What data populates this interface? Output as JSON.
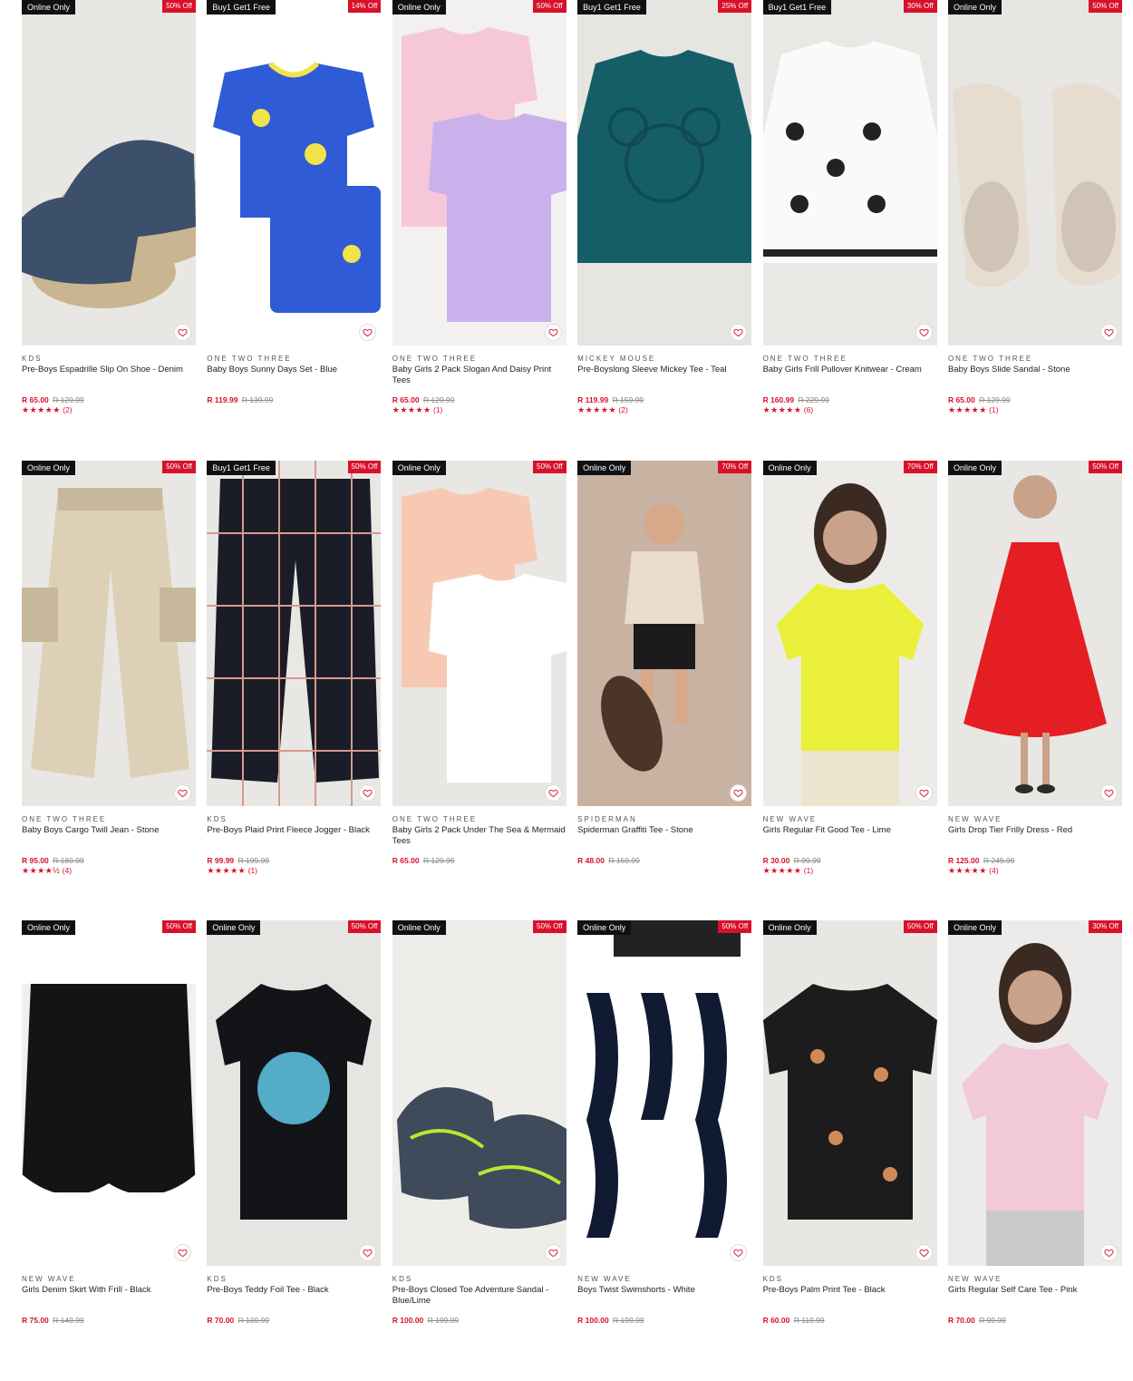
{
  "colors": {
    "accent": "#d8112b",
    "tag_bg": "#111111",
    "image_bg": "#e7e6e3"
  },
  "products": [
    {
      "tag": "Online Only",
      "discount": "50% Off",
      "brand": "KDS",
      "name": "Pre-Boys Espadrille Slip On Shoe - Denim",
      "price": "R 65.00",
      "was": "R 129.99",
      "stars": "★★★★★",
      "reviews": "(2)",
      "art": "shoe",
      "bg": "#e8e7e4",
      "c1": "#3c4f6b",
      "c2": "#c9b590"
    },
    {
      "tag": "Buy1 Get1 Free",
      "discount": "14% Off",
      "brand": "ONE TWO THREE",
      "name": "Baby Boys Sunny Days Set - Blue",
      "price": "R 119.99",
      "was": "R 139.99",
      "stars": "",
      "reviews": "",
      "art": "tee-set",
      "bg": "#ffffff",
      "c1": "#2f5bd6",
      "c2": "#f3e34a"
    },
    {
      "tag": "Online Only",
      "discount": "50% Off",
      "brand": "ONE TWO THREE",
      "name": "Baby Girls 2 Pack Slogan And Daisy Print Tees",
      "price": "R 65.00",
      "was": "R 129.99",
      "stars": "★★★★★",
      "reviews": "(1)",
      "art": "two-tees",
      "bg": "#f2f1ef",
      "c1": "#f6c7d8",
      "c2": "#c9b2ec"
    },
    {
      "tag": "Buy1 Get1 Free",
      "discount": "25% Off",
      "brand": "MICKEY MOUSE",
      "name": "Pre-Boyslong Sleeve Mickey Tee - Teal",
      "price": "R 119.99",
      "was": "R 159.99",
      "stars": "★★★★★",
      "reviews": "(2)",
      "art": "longsleeve",
      "bg": "#e6e5e2",
      "c1": "#155e68",
      "c2": "#0f4b53"
    },
    {
      "tag": "Buy1 Get1 Free",
      "discount": "30% Off",
      "brand": "ONE TWO THREE",
      "name": "Baby Girls Frill Pullover Knitwear - Cream",
      "price": "R 160.99",
      "was": "R 229.99",
      "stars": "★★★★★",
      "reviews": "(6)",
      "art": "knit",
      "bg": "#e9e8e5",
      "c1": "#fafafa",
      "c2": "#222222"
    },
    {
      "tag": "Online Only",
      "discount": "50% Off",
      "brand": "ONE TWO THREE",
      "name": "Baby Boys Slide Sandal - Stone",
      "price": "R 65.00",
      "was": "R 129.99",
      "stars": "★★★★★",
      "reviews": "(1)",
      "art": "slides",
      "bg": "#e7e6e3",
      "c1": "#e6dccf",
      "c2": "#cfc4b5"
    },
    {
      "tag": "Online Only",
      "discount": "50% Off",
      "brand": "ONE TWO THREE",
      "name": "Baby Boys Cargo Twill Jean - Stone",
      "price": "R 95.00",
      "was": "R 189.99",
      "stars": "★★★★½",
      "reviews": "(4)",
      "art": "pants",
      "bg": "#e8e7e4",
      "c1": "#ddd0b6",
      "c2": "#c7b89b"
    },
    {
      "tag": "Buy1 Get1 Free",
      "discount": "50% Off",
      "brand": "KDS",
      "name": "Pre-Boys Plaid Print Fleece Jogger - Black",
      "price": "R 99.99",
      "was": "R 199.99",
      "stars": "★★★★★",
      "reviews": "(1)",
      "art": "plaid",
      "bg": "#e8e7e4",
      "c1": "#1a1d27",
      "c2": "#d59a8f"
    },
    {
      "tag": "Online Only",
      "discount": "50% Off",
      "brand": "ONE TWO THREE",
      "name": "Baby Girls 2 Pack Under The Sea & Mermaid Tees",
      "price": "R 65.00",
      "was": "R 129.99",
      "stars": "",
      "reviews": "",
      "art": "two-tees",
      "bg": "#e8e7e4",
      "c1": "#f7c9b2",
      "c2": "#ffffff"
    },
    {
      "tag": "Online Only",
      "discount": "70% Off",
      "brand": "SPIDERMAN",
      "name": "Spiderman Graffiti Tee - Stone",
      "price": "R 48.00",
      "was": "R 159.99",
      "stars": "",
      "reviews": "",
      "art": "kid",
      "bg": "#c8b2a1",
      "c1": "#e9dccd",
      "c2": "#1b1b1b"
    },
    {
      "tag": "Online Only",
      "discount": "70% Off",
      "brand": "NEW WAVE",
      "name": "Girls Regular Fit Good Tee - Lime",
      "price": "R 30.00",
      "was": "R 99.99",
      "stars": "★★★★★",
      "reviews": "(1)",
      "art": "model-tee",
      "bg": "#ecebe8",
      "c1": "#eaf03a",
      "c2": "#ede4d0"
    },
    {
      "tag": "Online Only",
      "discount": "50% Off",
      "brand": "NEW WAVE",
      "name": "Girls Drop Tier Frilly Dress - Red",
      "price": "R 125.00",
      "was": "R 249.99",
      "stars": "★★★★★",
      "reviews": "(4)",
      "art": "dress",
      "bg": "#e8e7e4",
      "c1": "#e51e23",
      "c2": "#2b2b2b"
    },
    {
      "tag": "Online Only",
      "discount": "50% Off",
      "brand": "NEW WAVE",
      "name": "Girls Denim Skirt With Frill - Black",
      "price": "R 75.00",
      "was": "R 149.99",
      "stars": "",
      "reviews": "",
      "art": "skirt",
      "bg": "#f1f0ee",
      "c1": "#141414",
      "c2": "#ffffff"
    },
    {
      "tag": "Online Only",
      "discount": "50% Off",
      "brand": "KDS",
      "name": "Pre-Boys Teddy Foil Tee - Black",
      "price": "R 70.00",
      "was": "R 139.99",
      "stars": "",
      "reviews": "",
      "art": "black-tee",
      "bg": "#e6e5e2",
      "c1": "#121418",
      "c2": "#5fc7e8"
    },
    {
      "tag": "Online Only",
      "discount": "50% Off",
      "brand": "KDS",
      "name": "Pre-Boys Closed Toe Adventure Sandal - Blue/Lime",
      "price": "R 100.00",
      "was": "R 199.99",
      "stars": "",
      "reviews": "",
      "art": "sandals",
      "bg": "#eeede9",
      "c1": "#3f4a5a",
      "c2": "#b8e830"
    },
    {
      "tag": "Online Only",
      "discount": "50% Off",
      "brand": "NEW WAVE",
      "name": "Boys Twist Swimshorts - White",
      "price": "R 100.00",
      "was": "R 199.99",
      "stars": "",
      "reviews": "",
      "art": "swim",
      "bg": "#ffffff",
      "c1": "#111a33",
      "c2": "#ffffff"
    },
    {
      "tag": "Online Only",
      "discount": "50% Off",
      "brand": "KDS",
      "name": "Pre-Boys Palm Print Tee - Black",
      "price": "R 60.00",
      "was": "R 119.99",
      "stars": "",
      "reviews": "",
      "art": "palm-tee",
      "bg": "#e8e7e4",
      "c1": "#1c1c1c",
      "c2": "#d08a5a"
    },
    {
      "tag": "Online Only",
      "discount": "30% Off",
      "brand": "NEW WAVE",
      "name": "Girls Regular Self Care Tee - Pink",
      "price": "R 70.00",
      "was": "R 99.99",
      "stars": "",
      "reviews": "",
      "art": "model-tee",
      "bg": "#ecebe9",
      "c1": "#f2c9d8",
      "c2": "#c9c9cc"
    }
  ]
}
